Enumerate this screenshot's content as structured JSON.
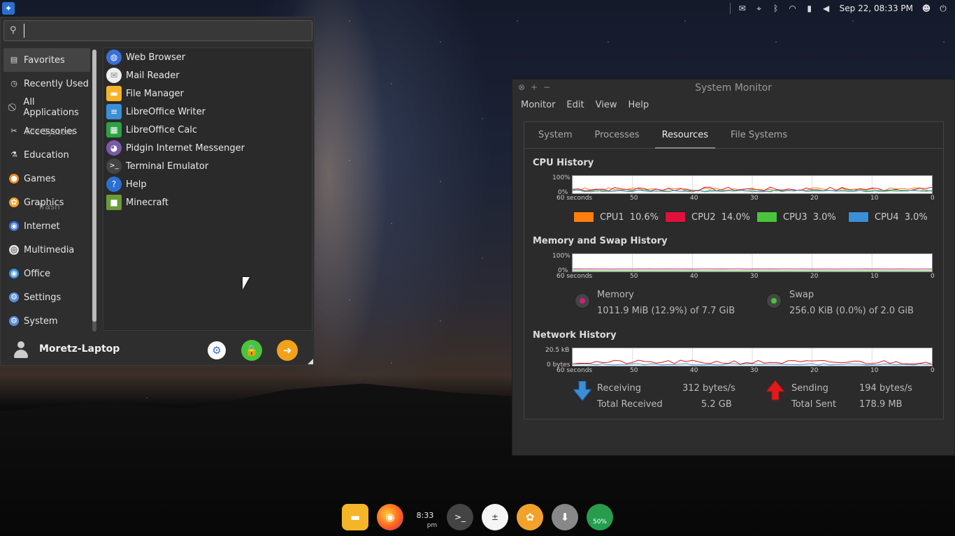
{
  "colors": {
    "accent_blue": "#2b6fd1",
    "cpu1": "#ff7f0e",
    "cpu2": "#e0103a",
    "cpu3": "#4ac43a",
    "cpu4": "#3a8fd6",
    "receiving": "#3a8fd6",
    "sending": "#e01a1a"
  },
  "top_panel": {
    "clock": "Sep 22, 08:33 PM"
  },
  "whisker": {
    "search_placeholder": "",
    "categories": [
      {
        "label": "Favorites",
        "icon": "favorites-icon"
      },
      {
        "label": "Recently Used",
        "icon": "recent-icon"
      },
      {
        "label": "All Applications",
        "icon": "all-apps-icon"
      },
      {
        "label": "Accessories",
        "icon": "accessories-icon"
      },
      {
        "label": "Education",
        "icon": "education-icon"
      },
      {
        "label": "Games",
        "icon": "games-icon"
      },
      {
        "label": "Graphics",
        "icon": "graphics-icon"
      },
      {
        "label": "Internet",
        "icon": "internet-icon"
      },
      {
        "label": "Multimedia",
        "icon": "multimedia-icon"
      },
      {
        "label": "Office",
        "icon": "office-icon"
      },
      {
        "label": "Settings",
        "icon": "settings-icon"
      },
      {
        "label": "System",
        "icon": "system-icon"
      }
    ],
    "apps": [
      {
        "label": "Web Browser",
        "icon": "web-browser-icon"
      },
      {
        "label": "Mail Reader",
        "icon": "mail-reader-icon"
      },
      {
        "label": "File Manager",
        "icon": "file-manager-icon"
      },
      {
        "label": "LibreOffice Writer",
        "icon": "writer-icon"
      },
      {
        "label": "LibreOffice Calc",
        "icon": "calc-icon"
      },
      {
        "label": "Pidgin Internet Messenger",
        "icon": "pidgin-icon"
      },
      {
        "label": "Terminal Emulator",
        "icon": "terminal-icon"
      },
      {
        "label": "Help",
        "icon": "help-icon"
      },
      {
        "label": "Minecraft",
        "icon": "minecraft-icon"
      }
    ],
    "user_name": "Moretz-Laptop"
  },
  "desktop": {
    "file_system_label": "File System",
    "trash_label": "Trash"
  },
  "sysmon": {
    "title": "System Monitor",
    "menu": [
      "Monitor",
      "Edit",
      "View",
      "Help"
    ],
    "tabs": [
      "System",
      "Processes",
      "Resources",
      "File Systems"
    ],
    "active_tab": "Resources",
    "cpu_title": "CPU History",
    "mem_title": "Memory and Swap History",
    "net_title": "Network History",
    "cpu_y_top": "100%",
    "cpu_y_bottom": "0%",
    "mem_y_top": "100%",
    "mem_y_bottom": "0%",
    "net_y_top": "20.5 kB",
    "net_y_bottom": "0 bytes",
    "x_ticks": [
      "60 seconds",
      "50",
      "40",
      "30",
      "20",
      "10",
      "0"
    ],
    "cpu_legend": [
      {
        "name": "CPU1",
        "value": "10.6%"
      },
      {
        "name": "CPU2",
        "value": "14.0%"
      },
      {
        "name": "CPU3",
        "value": "3.0%"
      },
      {
        "name": "CPU4",
        "value": "3.0%"
      }
    ],
    "memory": {
      "label": "Memory",
      "value": "1011.9 MiB (12.9%) of 7.7 GiB"
    },
    "swap": {
      "label": "Swap",
      "value": "256.0 KiB (0.0%) of 2.0 GiB"
    },
    "network": {
      "receiving_label": "Receiving",
      "receiving_value": "312 bytes/s",
      "total_received_label": "Total Received",
      "total_received_value": "5.2 GB",
      "sending_label": "Sending",
      "sending_value": "194 bytes/s",
      "total_sent_label": "Total Sent",
      "total_sent_value": "178.9 MB"
    }
  },
  "dock": {
    "clock_time": "8:33",
    "clock_ampm": "pm",
    "battery_label": "50%"
  }
}
